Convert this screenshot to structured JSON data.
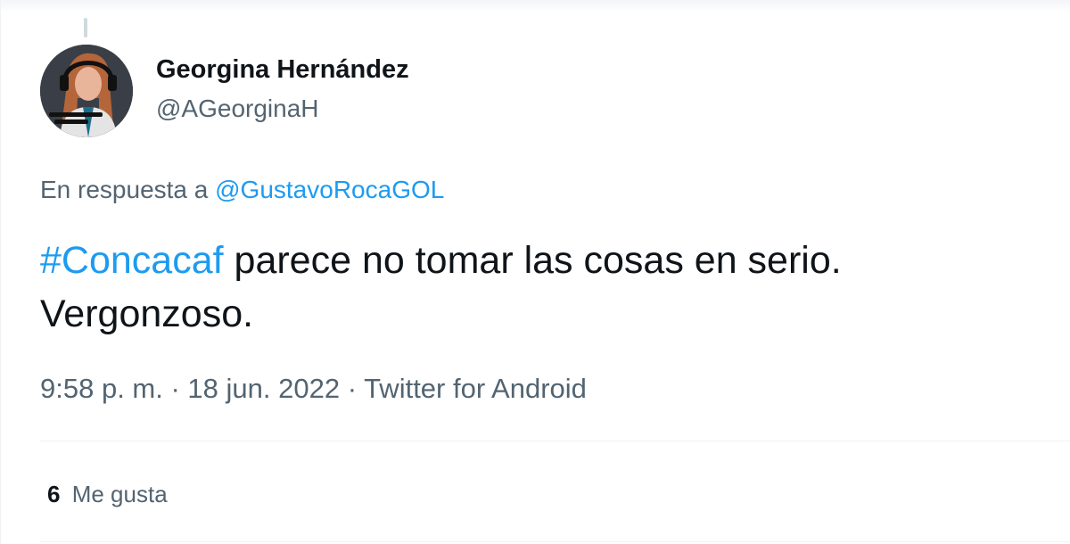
{
  "author": {
    "display_name": "Georgina Hernández",
    "handle": "@AGeorginaH"
  },
  "reply": {
    "prefix": "En respuesta a",
    "mention": "@GustavoRocaGOL"
  },
  "tweet": {
    "hashtag": "#Concacaf",
    "text": " parece no tomar las cosas en serio. Vergonzoso."
  },
  "meta": {
    "time": "9:58 p. m.",
    "date": "18 jun. 2022",
    "source": "Twitter for Android",
    "separator": " · "
  },
  "stats": {
    "likes_count": "6",
    "likes_label": "Me gusta"
  },
  "colors": {
    "link": "#1d9bf0",
    "text": "#0f1419",
    "secondary": "#536471"
  }
}
